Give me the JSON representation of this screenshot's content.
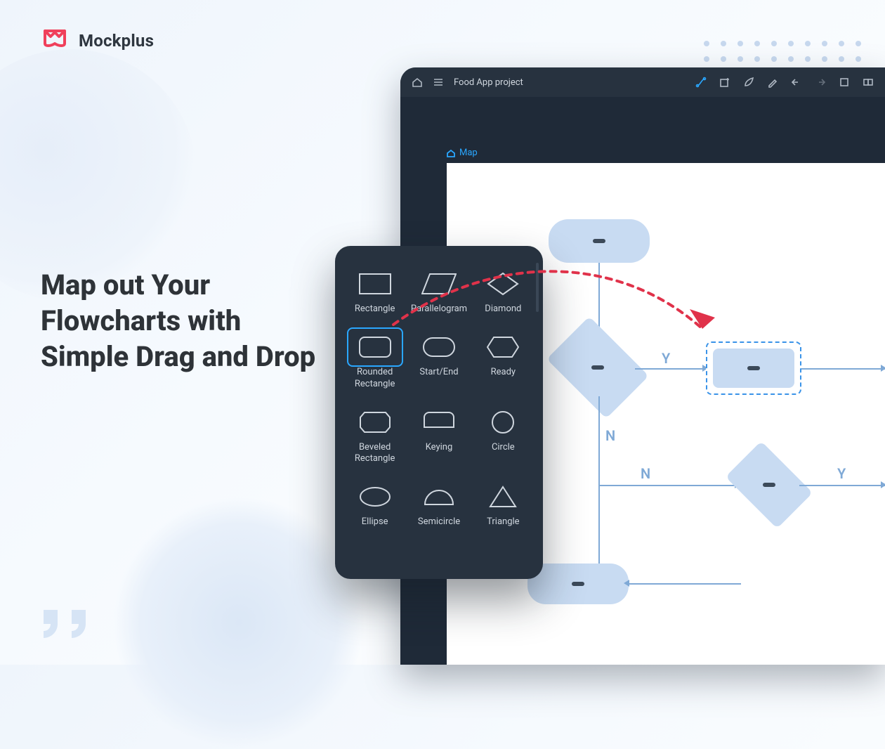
{
  "brand": {
    "name": "Mockplus"
  },
  "headline": "Map out Your Flowcharts with Simple Drag and Drop",
  "app": {
    "project_name": "Food App project",
    "breadcrumb": "Map"
  },
  "toolbar_right_icons": [
    "connector-icon",
    "add-icon",
    "leaf-icon",
    "pencil-icon",
    "undo-icon",
    "redo-icon",
    "crop-icon",
    "group-icon"
  ],
  "canvas_labels": {
    "yes1": "Y",
    "no1": "N",
    "no2": "N",
    "yes2": "Y"
  },
  "shapes": [
    {
      "id": "rectangle",
      "label": "Rectangle"
    },
    {
      "id": "parallelogram",
      "label": "Parallelogram"
    },
    {
      "id": "diamond",
      "label": "Diamond"
    },
    {
      "id": "rounded-rectangle",
      "label": "Rounded Rectangle",
      "selected": true
    },
    {
      "id": "start-end",
      "label": "Start/End"
    },
    {
      "id": "ready",
      "label": "Ready"
    },
    {
      "id": "beveled-rectangle",
      "label": "Beveled Rectangle"
    },
    {
      "id": "keying",
      "label": "Keying"
    },
    {
      "id": "circle",
      "label": "Circle"
    },
    {
      "id": "ellipse",
      "label": "Ellipse"
    },
    {
      "id": "semicircle",
      "label": "Semicircle"
    },
    {
      "id": "triangle",
      "label": "Triangle"
    }
  ]
}
